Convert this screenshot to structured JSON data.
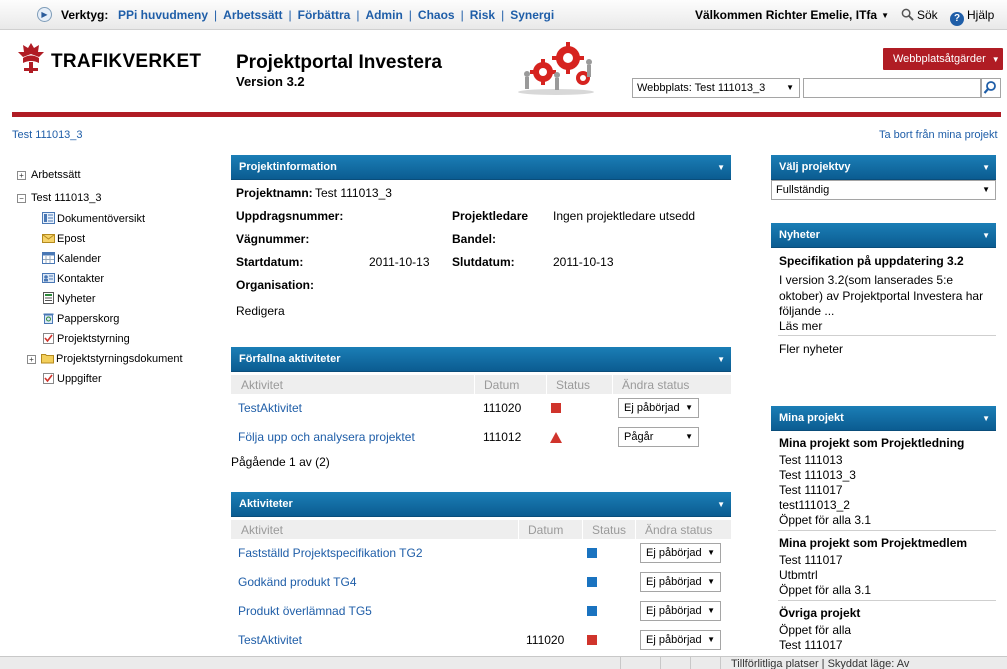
{
  "topbar": {
    "tools_label": "Verktyg:",
    "tools": [
      "PPi huvudmeny",
      "Arbetssätt",
      "Förbättra",
      "Admin",
      "Chaos",
      "Risk",
      "Synergi"
    ],
    "welcome": "Välkommen Richter Emelie, ITfa",
    "search": "Sök",
    "help": "Hjälp"
  },
  "header": {
    "logo_text": "TRAFIKVERKET",
    "title": "Projektportal Investera",
    "version": "Version 3.2",
    "actions_button": "Webbplatsåtgärder",
    "site_select": "Webbplats: Test 111013_3",
    "search_value": ""
  },
  "breadcrumb": "Test 111013_3",
  "remove_link": "Ta bort från mina projekt",
  "nav": {
    "items": [
      {
        "label": "Arbetssätt",
        "icon": "expand-icon"
      },
      {
        "label": "Test 111013_3",
        "icon": "collapse-icon"
      },
      {
        "label": "Dokumentöversikt",
        "icon": "document-library-icon"
      },
      {
        "label": "Epost",
        "icon": "mail-icon"
      },
      {
        "label": "Kalender",
        "icon": "calendar-icon"
      },
      {
        "label": "Kontakter",
        "icon": "contacts-icon"
      },
      {
        "label": "Nyheter",
        "icon": "news-icon"
      },
      {
        "label": "Papperskorg",
        "icon": "recycle-bin-icon"
      },
      {
        "label": "Projektstyrning",
        "icon": "task-icon"
      },
      {
        "label": "Projektstyrningsdokument",
        "icon": "folder-icon"
      },
      {
        "label": "Uppgifter",
        "icon": "task-icon"
      }
    ]
  },
  "project_info": {
    "title": "Projektinformation",
    "name_label": "Projektnamn:",
    "name_value": "Test 111013_3",
    "assignment_label": "Uppdragsnummer:",
    "manager_label": "Projektledare",
    "manager_value": "Ingen projektledare utsedd",
    "road_label": "Vägnummer:",
    "section_label": "Bandel:",
    "start_label": "Startdatum:",
    "start_value": "2011-10-13",
    "end_label": "Slutdatum:",
    "end_value": "2011-10-13",
    "org_label": "Organisation:",
    "edit_link": "Redigera"
  },
  "overdue": {
    "title": "Förfallna aktiviteter",
    "columns": [
      "Aktivitet",
      "Datum",
      "Status",
      "Ändra status"
    ],
    "rows": [
      {
        "activity": "TestAktivitet",
        "date": "111020",
        "status": "red-square",
        "change": "Ej påbörjad"
      },
      {
        "activity": "Följa upp och analysera projektet",
        "date": "111012",
        "status": "red-triangle",
        "change": "Pågår"
      }
    ],
    "paging": "Pågående 1 av (2)"
  },
  "activities": {
    "title": "Aktiviteter",
    "columns": [
      "Aktivitet",
      "Datum",
      "Status",
      "Ändra status"
    ],
    "rows": [
      {
        "activity": "Fastställd Projektspecifikation TG2",
        "date": "",
        "status": "blue-square",
        "change": "Ej påbörjad"
      },
      {
        "activity": "Godkänd produkt TG4",
        "date": "",
        "status": "blue-square",
        "change": "Ej påbörjad"
      },
      {
        "activity": "Produkt överlämnad TG5",
        "date": "",
        "status": "blue-square",
        "change": "Ej påbörjad"
      },
      {
        "activity": "TestAktivitet",
        "date": "111020",
        "status": "red-square",
        "change": "Ej påbörjad"
      }
    ]
  },
  "view_picker": {
    "title": "Välj projektvy",
    "selected": "Fullständig"
  },
  "news": {
    "title": "Nyheter",
    "headline": "Specifikation på uppdatering 3.2",
    "body_lines": [
      "I version 3.2(som lanserades 5:e",
      "oktober) av Projektportal Investera har",
      "följande ..."
    ],
    "read_more": "Läs mer",
    "more_news": "Fler nyheter"
  },
  "my_projects": {
    "title": "Mina projekt",
    "lead_heading": "Mina projekt som Projektledning",
    "lead_items": [
      "Test 111013",
      "Test 111013_3",
      "Test 111017",
      "test111013_2",
      "Öppet för alla 3.1"
    ],
    "member_heading": "Mina projekt som Projektmedlem",
    "member_items": [
      "Test 111017",
      "Utbmtrl",
      "Öppet för alla 3.1"
    ],
    "other_heading": "Övriga projekt",
    "other_items": [
      "Öppet för alla",
      "Test 111017"
    ]
  },
  "statusbar": {
    "text": "Tillförlitliga platser | Skyddat läge: Av"
  },
  "colors": {
    "accent": "#1f5ea8",
    "brand_red": "#b01c24",
    "webpart_header": "#0b6ea8",
    "status_red": "#d0342c",
    "status_blue": "#1a73c0"
  }
}
